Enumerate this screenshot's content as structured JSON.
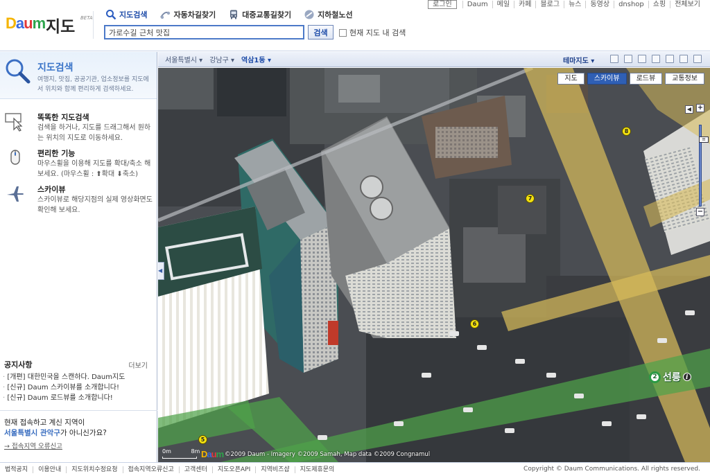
{
  "brand": {
    "logo_letters": [
      "D",
      "a",
      "u",
      "m"
    ],
    "product": "지도",
    "beta": "BETA"
  },
  "tabs": [
    {
      "label": "지도검색",
      "icon": "search-icon",
      "active": true
    },
    {
      "label": "자동차길찾기",
      "icon": "car-route-icon",
      "active": false
    },
    {
      "label": "대중교통길찾기",
      "icon": "bus-icon",
      "active": false
    },
    {
      "label": "지하철노선",
      "icon": "subway-icon",
      "active": false
    }
  ],
  "search": {
    "value": "가로수길 근처 맛집",
    "button_label": "검색",
    "current_map_label": "현재 지도 내 검색"
  },
  "top_links": {
    "login": "로그인",
    "items": [
      "Daum",
      "메일",
      "카페",
      "블로그",
      "뉴스",
      "동영상",
      "dnshop",
      "쇼핑",
      "전체보기"
    ]
  },
  "left_panel": {
    "title": "지도검색",
    "desc": "여행지, 맛집, 공공기관, 업소정보를 지도에서 위치와 함께 편리하게 검색하세요.",
    "features": [
      {
        "title": "똑똑한 지도검색",
        "desc": "검색을 하거나, 지도를 드래그해서 원하는 위치의 지도로 이동하세요.",
        "icon": "drag-cursor-icon"
      },
      {
        "title": "편리한 기능",
        "desc": "마우스휠을 이용해 지도를 확대/축소 해보세요. (마우스휠 : ⬆확대 ⬇축소)",
        "icon": "mouse-icon"
      },
      {
        "title": "스카이뷰",
        "desc": "스카이뷰로 해당지점의 실제 영상화면도 확인해 보세요.",
        "icon": "airplane-icon"
      }
    ],
    "notice": {
      "title": "공지사항",
      "more": "더보기",
      "items": [
        "[개편] 대한민국을 스캔하다. Daum지도",
        "[신규] Daum 스카이뷰를 소개합니다!",
        "[신규] Daum 로드뷰를 소개합니다!"
      ]
    },
    "region": {
      "line1": "현재 접속하고 계신 지역이",
      "region_name": "서울특별시 관악구",
      "line2_suffix": "가 아니신가요?",
      "report": "→ 접속지역 오류신고"
    }
  },
  "map": {
    "breadcrumbs": [
      "서울특별시 ▾",
      "강남구 ▾",
      "역삼1동 ▾"
    ],
    "theme_label": "테마지도 ▾",
    "tools": [
      "print-icon",
      "save-icon",
      "email-icon",
      "link-icon",
      "printer-icon",
      "fullscreen-icon",
      "restore-icon"
    ],
    "view_buttons": [
      {
        "label": "지도",
        "active": false
      },
      {
        "label": "스카이뷰",
        "active": true
      },
      {
        "label": "로드뷰",
        "active": false
      },
      {
        "label": "교통정보",
        "active": false
      }
    ],
    "zoom_plus": "+",
    "zoom_minus": "−",
    "zoom_handle": "≡",
    "markers": [
      "5",
      "6",
      "7",
      "8"
    ],
    "station": {
      "line": "2",
      "name": "선릉",
      "info": "i"
    },
    "scale": {
      "left": "0m",
      "right": "8m"
    },
    "map_logo_letters": [
      "D",
      "a",
      "u",
      "m"
    ],
    "copyright": "©2009 Daum - Imagery ©2009 Samah, Map data ©2009 Congnamul"
  },
  "footer": {
    "links": [
      "법적공지",
      "이용안내",
      "지도위치수정요청",
      "접속지역오류신고",
      "고객센터",
      "지도오픈API",
      "지역비즈샵",
      "지도제휴문의"
    ],
    "copyright": "Copyright © Daum Communications. All rights reserved."
  },
  "colors": {
    "accent": "#2f5fb5",
    "road_yellow": "#d7bb5a",
    "road_green": "#4fa24a"
  }
}
